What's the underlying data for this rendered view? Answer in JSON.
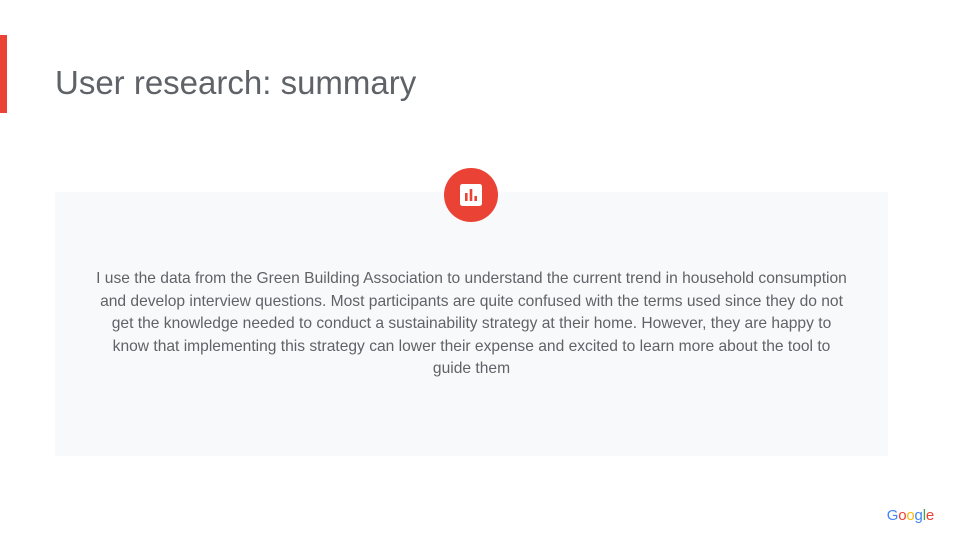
{
  "slide": {
    "title": "User research: summary",
    "summary": "I use the data from the Green Building Association to understand the current trend in household consumption and develop interview questions. Most participants are quite confused with the terms used since they do not get the knowledge needed to conduct a sustainability strategy at their home. However, they are happy to know that implementing this strategy can lower their expense and excited to learn more about the tool to guide them"
  },
  "badge": {
    "icon": "bar-chart-icon"
  },
  "logo": {
    "text": "Google",
    "colors": [
      "#4285f4",
      "#ea4335",
      "#fbbc05",
      "#4285f4",
      "#34a853",
      "#ea4335"
    ]
  },
  "colors": {
    "accent": "#ea4335",
    "text": "#5f6368",
    "card_background": "#f8f9fa"
  }
}
